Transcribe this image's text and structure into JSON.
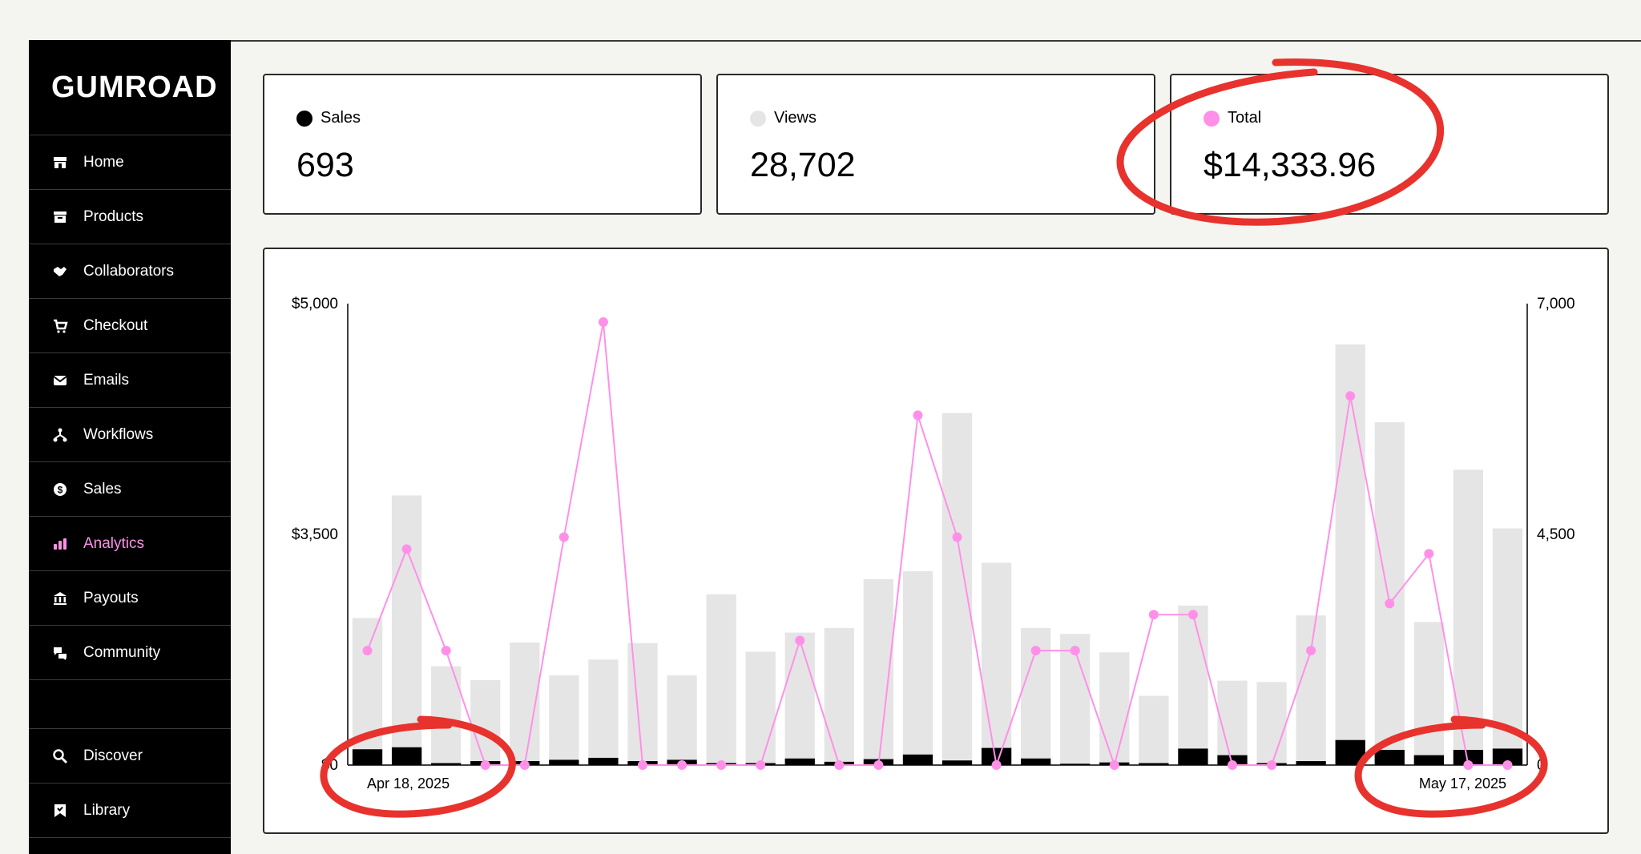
{
  "sidebar": {
    "logo": "GUMROAD",
    "items": [
      {
        "label": "Home",
        "icon": "home-icon"
      },
      {
        "label": "Products",
        "icon": "archive-box-icon"
      },
      {
        "label": "Collaborators",
        "icon": "handshake-icon"
      },
      {
        "label": "Checkout",
        "icon": "cart-icon"
      },
      {
        "label": "Emails",
        "icon": "envelope-icon"
      },
      {
        "label": "Workflows",
        "icon": "workflow-icon"
      },
      {
        "label": "Sales",
        "icon": "dollar-circle-icon"
      },
      {
        "label": "Analytics",
        "icon": "bar-chart-icon",
        "active": true
      },
      {
        "label": "Payouts",
        "icon": "bank-icon"
      },
      {
        "label": "Community",
        "icon": "chat-bubbles-icon"
      }
    ],
    "bottom_items": [
      {
        "label": "Discover",
        "icon": "search-icon"
      },
      {
        "label": "Library",
        "icon": "bookmark-icon"
      }
    ]
  },
  "stats": {
    "sales": {
      "label": "Sales",
      "value": "693",
      "color": "#000000"
    },
    "views": {
      "label": "Views",
      "value": "28,702",
      "color": "#e5e5e5"
    },
    "total": {
      "label": "Total",
      "value": "$14,333.96",
      "color": "#ff90e8"
    }
  },
  "colors": {
    "accent": "#ff90e8",
    "annotation": "#e8322d",
    "views_bar": "#e5e5e5"
  },
  "chart_data": {
    "type": "bar",
    "x_start_label": "Apr 18, 2025",
    "x_end_label": "May 17, 2025",
    "left_axis": {
      "ticks": [
        "$5,000",
        "$3,500",
        "$0"
      ],
      "range": [
        0,
        5000
      ]
    },
    "right_axis": {
      "ticks": [
        "7,000",
        "4,500",
        "0"
      ],
      "range": [
        0,
        7000
      ]
    },
    "series": [
      {
        "name": "Views",
        "axis": "right",
        "kind": "bar",
        "values": [
          2230,
          4090,
          1500,
          1290,
          1860,
          1360,
          1600,
          1850,
          1360,
          2590,
          1720,
          2010,
          2080,
          2820,
          2940,
          5340,
          3070,
          2080,
          1990,
          1710,
          1050,
          2420,
          1280,
          1260,
          2270,
          6380,
          5200,
          2170,
          4480,
          3590
        ]
      },
      {
        "name": "Sales",
        "axis": "right",
        "kind": "bar",
        "values": [
          240,
          270,
          30,
          60,
          60,
          80,
          110,
          60,
          80,
          30,
          30,
          100,
          50,
          90,
          160,
          70,
          260,
          100,
          20,
          40,
          30,
          250,
          150,
          30,
          60,
          380,
          230,
          150,
          230,
          250
        ]
      },
      {
        "name": "Total",
        "axis": "left",
        "kind": "line",
        "values": [
          1240,
          2340,
          1240,
          0,
          0,
          2470,
          4800,
          0,
          0,
          0,
          0,
          1350,
          0,
          0,
          3790,
          2470,
          0,
          1240,
          1240,
          0,
          1630,
          1630,
          0,
          0,
          1240,
          4000,
          1750,
          2290,
          0,
          0
        ]
      }
    ]
  }
}
